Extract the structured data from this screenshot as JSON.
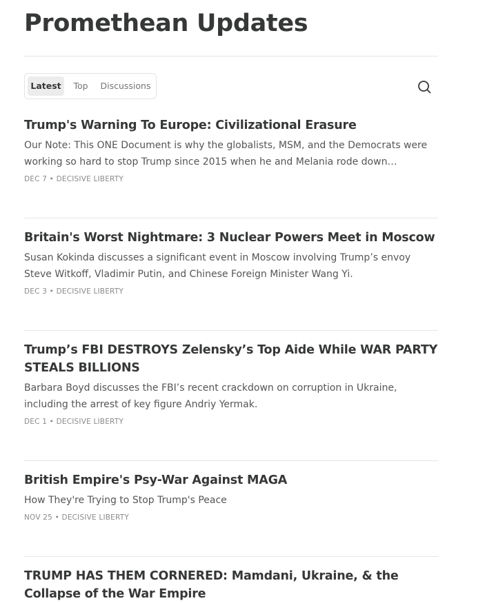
{
  "publication": {
    "title": "Promethean Updates"
  },
  "tabs": [
    {
      "label": "Latest",
      "active": true
    },
    {
      "label": "Top",
      "active": false
    },
    {
      "label": "Discussions",
      "active": false
    }
  ],
  "search": {
    "icon": "search-icon"
  },
  "posts": [
    {
      "title": "Trump's Warning To Europe: Civilizational Erasure",
      "subtitle": "Our Note: This ONE Document is why the globalists, MSM, and the Democrats were working so hard to stop Trump since 2015 when he and Melania rode down…",
      "date": "DEC 7",
      "author": "DECISIVE LIBERTY"
    },
    {
      "title": "Britain's Worst Nightmare: 3 Nuclear Powers Meet in Moscow",
      "subtitle": "Susan Kokinda discusses a significant event in Moscow involving Trump’s envoy Steve Witkoff, Vladimir Putin, and Chinese Foreign Minister Wang Yi.",
      "date": "DEC 3",
      "author": "DECISIVE LIBERTY"
    },
    {
      "title": "Trump’s FBI DESTROYS Zelensky’s Top Aide While WAR PARTY STEALS BILLIONS",
      "subtitle": "Barbara Boyd discusses the FBI’s recent crackdown on corruption in Ukraine, including the arrest of key figure Andriy Yermak.",
      "date": "DEC 1",
      "author": "DECISIVE LIBERTY"
    },
    {
      "title": "British Empire's Psy-War Against MAGA",
      "subtitle": "How They're Trying to Stop Trump's Peace",
      "date": "NOV 25",
      "author": "DECISIVE LIBERTY"
    },
    {
      "title": "TRUMP HAS THEM CORNERED: Mamdani, Ukraine, & the Collapse of the War Empire",
      "subtitle": "",
      "date": "",
      "author": ""
    }
  ],
  "meta_separator": "•"
}
